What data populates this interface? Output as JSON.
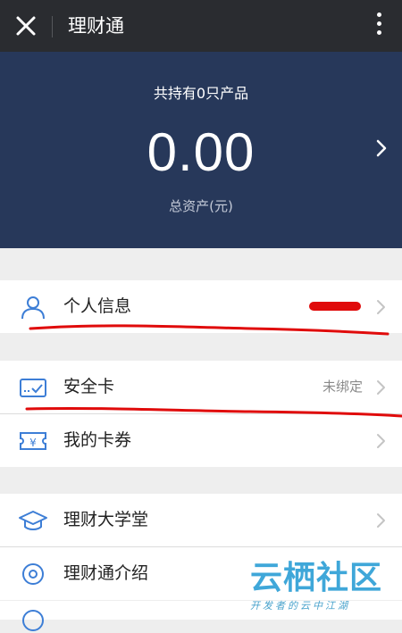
{
  "header": {
    "title": "理财通",
    "close_icon": "close-icon",
    "more_icon": "more-vertical-icon"
  },
  "summary": {
    "holding_text": "共持有0只产品",
    "total_amount": "0.00",
    "caption": "总资产(元)",
    "accent_color": "#27385a"
  },
  "menu": {
    "personal_info": {
      "label": "个人信息",
      "icon": "user-icon"
    },
    "security_card": {
      "label": "安全卡",
      "value": "未绑定",
      "icon": "card-icon"
    },
    "coupons": {
      "label": "我的卡券",
      "icon": "coupon-icon"
    },
    "university": {
      "label": "理财大学堂",
      "icon": "graduation-cap-icon"
    },
    "intro": {
      "label": "理财通介绍",
      "icon": "info-icon"
    }
  },
  "watermark": {
    "title": "云栖社区",
    "subtitle": "开发者的云中江湖"
  }
}
